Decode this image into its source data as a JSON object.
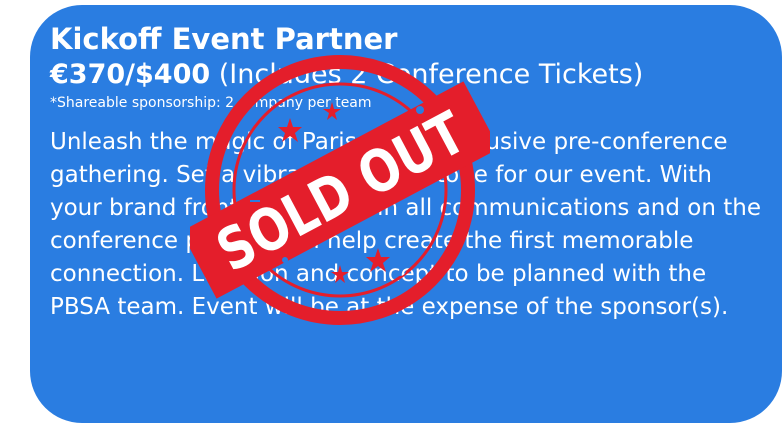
{
  "card": {
    "title": "Kickoff Event Partner",
    "price": "€370/$400",
    "price_note": "(Includes 2 Conference Tickets)",
    "shareable_note": "*Shareable sponsorship: 2 company per team",
    "description": "Unleash the magic of Paris at the exclusive pre-conference gathering. Set a vibrant, Parisian tone for our event. With your brand front and centre in all communications and on the conference page, you’ll help create the first memorable connection. Location and concept to be planned with the PBSA team. Event will be at the expense of the sponsor(s)."
  },
  "stamp": {
    "text": "SOLD OUT",
    "color": "#e41e2b"
  },
  "colors": {
    "card_bg": "#2a7de1",
    "text": "#ffffff"
  }
}
